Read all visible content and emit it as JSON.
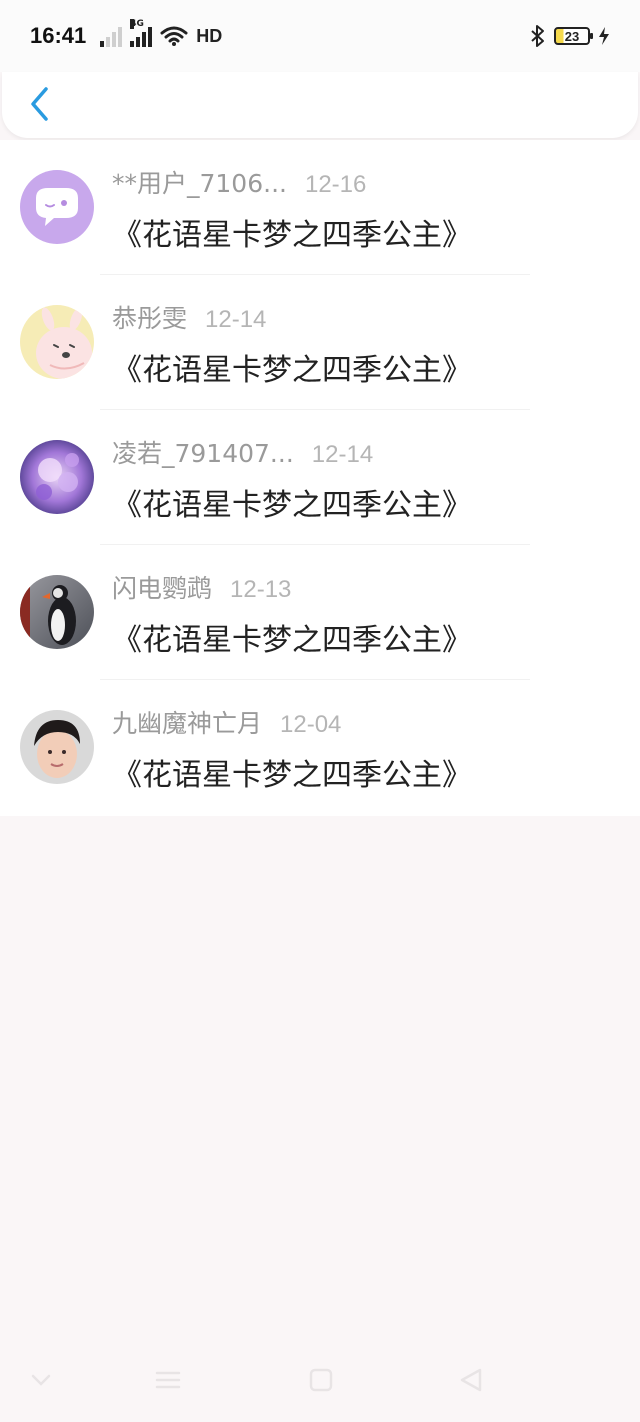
{
  "status_bar": {
    "time": "16:41",
    "network_label": "4G",
    "wifi_label": "HD",
    "battery_level": "23",
    "icons": [
      "signal-no-sim-icon",
      "signal-4g-icon",
      "wifi-icon",
      "hd-icon",
      "bluetooth-icon",
      "battery-icon",
      "charging-icon"
    ]
  },
  "header": {
    "back_icon": "chevron-left-icon",
    "accent_color": "#2a9be0"
  },
  "list": {
    "items": [
      {
        "name": "**用户_7106...",
        "date": "12-16",
        "title": "《花语星卡梦之四季公主》",
        "avatar": "chat-bubble-avatar"
      },
      {
        "name": "恭彤雯",
        "date": "12-14",
        "title": "《花语星卡梦之四季公主》",
        "avatar": "bunny-avatar"
      },
      {
        "name": "凌若_791407...",
        "date": "12-14",
        "title": "《花语星卡梦之四季公主》",
        "avatar": "flower-avatar"
      },
      {
        "name": "闪电鹦鹉",
        "date": "12-13",
        "title": "《花语星卡梦之四季公主》",
        "avatar": "puffin-avatar"
      },
      {
        "name": "九幽魔神亡月",
        "date": "12-04",
        "title": "《花语星卡梦之四季公主》",
        "avatar": "portrait-avatar"
      }
    ]
  },
  "nav_bar": {
    "icons": [
      "collapse-icon",
      "menu-icon",
      "home-icon",
      "back-icon"
    ]
  }
}
